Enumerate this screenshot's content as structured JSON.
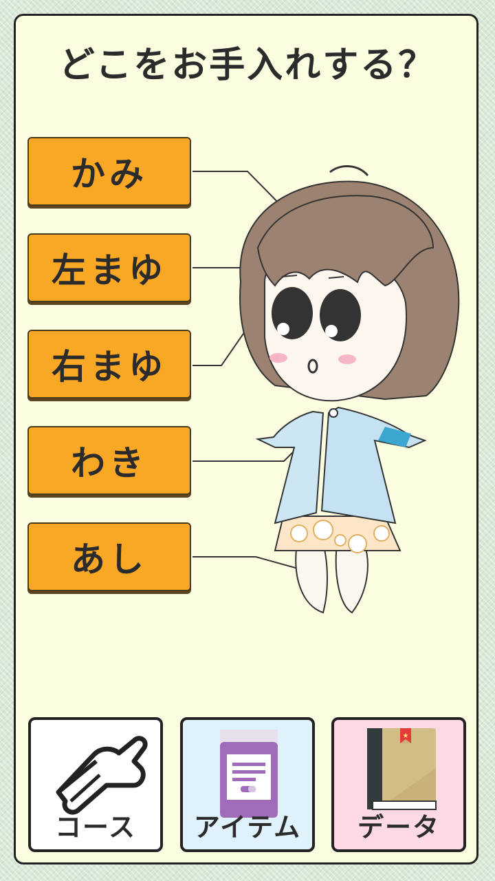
{
  "title": "どこをお手入れする？",
  "parts": [
    {
      "label": "かみ"
    },
    {
      "label": "左まゆ"
    },
    {
      "label": "右まゆ"
    },
    {
      "label": "わき"
    },
    {
      "label": "あし"
    }
  ],
  "nav": {
    "course": {
      "label": "コース",
      "icon": "hand-pointer-icon",
      "bg": "#ffffff"
    },
    "item": {
      "label": "アイテム",
      "icon": "jar-icon",
      "bg": "#dff1fb"
    },
    "data": {
      "label": "データ",
      "icon": "book-icon",
      "bg": "#fdd9e3"
    }
  },
  "colors": {
    "button": "#f9a825",
    "panel": "#fbfde0",
    "hair": "#9c8270",
    "jacket": "#bfe0f0"
  }
}
